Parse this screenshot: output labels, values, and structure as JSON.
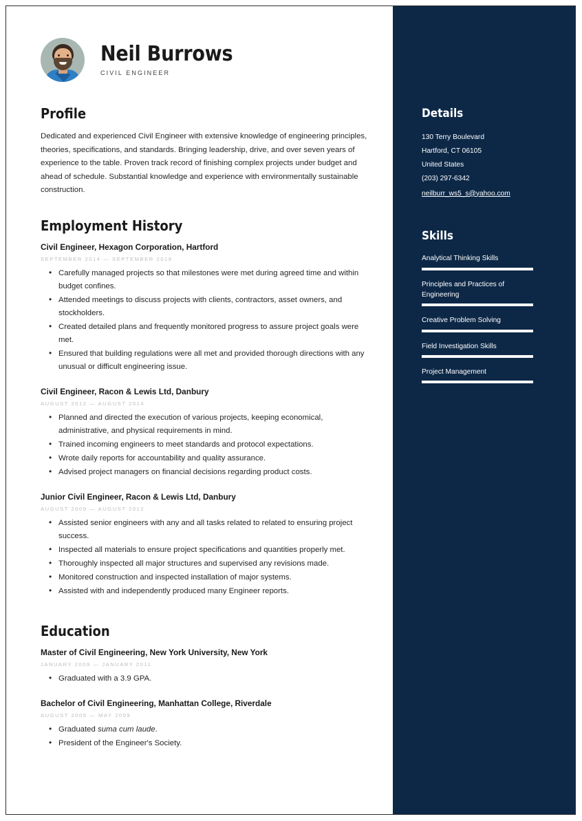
{
  "theme": {
    "navy": "#0d2847",
    "text_dark": "#262626",
    "date_gray": "#bdbdbd",
    "white": "#ffffff"
  },
  "header": {
    "name": "Neil Burrows",
    "job_title": "CIVIL ENGINEER",
    "avatar_alt": "portrait-photo"
  },
  "profile": {
    "heading": "Profile",
    "text": "Dedicated and experienced Civil Engineer with extensive knowledge of engineering principles, theories, specifications, and standards. Bringing leadership, drive, and over seven years of experience to the table. Proven track record of finishing complex projects under budget and ahead of schedule. Substantial knowledge and experience with environmentally sustainable construction."
  },
  "employment": {
    "heading": "Employment History",
    "entries": [
      {
        "title": "Civil Engineer, Hexagon Corporation, Hartford",
        "date": "SEPTEMBER 2014 — SEPTEMBER 2019",
        "bullets": [
          "Carefully managed projects so that milestones were met during agreed time and within budget confines.",
          "Attended meetings to discuss projects with clients, contractors, asset owners, and stockholders.",
          "Created detailed plans and frequently monitored progress to assure project goals were met.",
          "Ensured that building regulations were all met and provided thorough directions with any unusual or difficult engineering issue."
        ]
      },
      {
        "title": "Civil Engineer, Racon & Lewis Ltd, Danbury",
        "date": "AUGUST 2012 — AUGUST 2014",
        "bullets": [
          "Planned and directed the execution of various projects, keeping economical, administrative, and physical requirements in mind.",
          "Trained incoming engineers to meet standards and protocol expectations.",
          "Wrote daily reports for accountability and quality assurance.",
          "Advised project managers on financial decisions regarding product costs."
        ]
      },
      {
        "title": "Junior Civil Engineer, Racon & Lewis Ltd, Danbury",
        "date": "AUGUST 2009 — AUGUST 2012",
        "bullets": [
          "Assisted senior engineers with any and all tasks related to related to ensuring project success.",
          "Inspected all materials to ensure project specifications and quantities properly met.",
          "Thoroughly inspected all major structures and supervised any revisions made.",
          "Monitored construction and inspected installation of major systems.",
          "Assisted with and independently produced many Engineer reports."
        ]
      }
    ]
  },
  "education": {
    "heading": "Education",
    "entries": [
      {
        "title": "Master of Civil Engineering, New York University, New York",
        "date": "JANUARY 2009 — JANUARY 2011",
        "bullets": [
          {
            "pre": "Graduated with a 3.9 GPA.",
            "em": "",
            "post": ""
          }
        ]
      },
      {
        "title": "Bachelor of Civil Engineering, Manhattan College, Riverdale",
        "date": "AUGUST 2005 — MAY 2009",
        "bullets": [
          {
            "pre": "Graduated ",
            "em": "suma cum laude",
            "post": "."
          },
          {
            "pre": "President of the Engineer's Society.",
            "em": "",
            "post": ""
          }
        ]
      }
    ]
  },
  "details": {
    "heading": "Details",
    "address_line1": "130 Terry Boulevard",
    "address_line2": "Hartford, CT 06105",
    "country": "United States",
    "phone": "(203) 297-6342",
    "email": "neilburr_ws5_s@yahoo.com"
  },
  "skills": {
    "heading": "Skills",
    "items": [
      {
        "name": "Analytical Thinking Skills",
        "level": 100
      },
      {
        "name": "Principles and Practices of Engineering",
        "level": 100
      },
      {
        "name": "Creative Problem Solving",
        "level": 100
      },
      {
        "name": "Field Investigation Skills",
        "level": 100
      },
      {
        "name": "Project Management",
        "level": 100
      }
    ]
  }
}
